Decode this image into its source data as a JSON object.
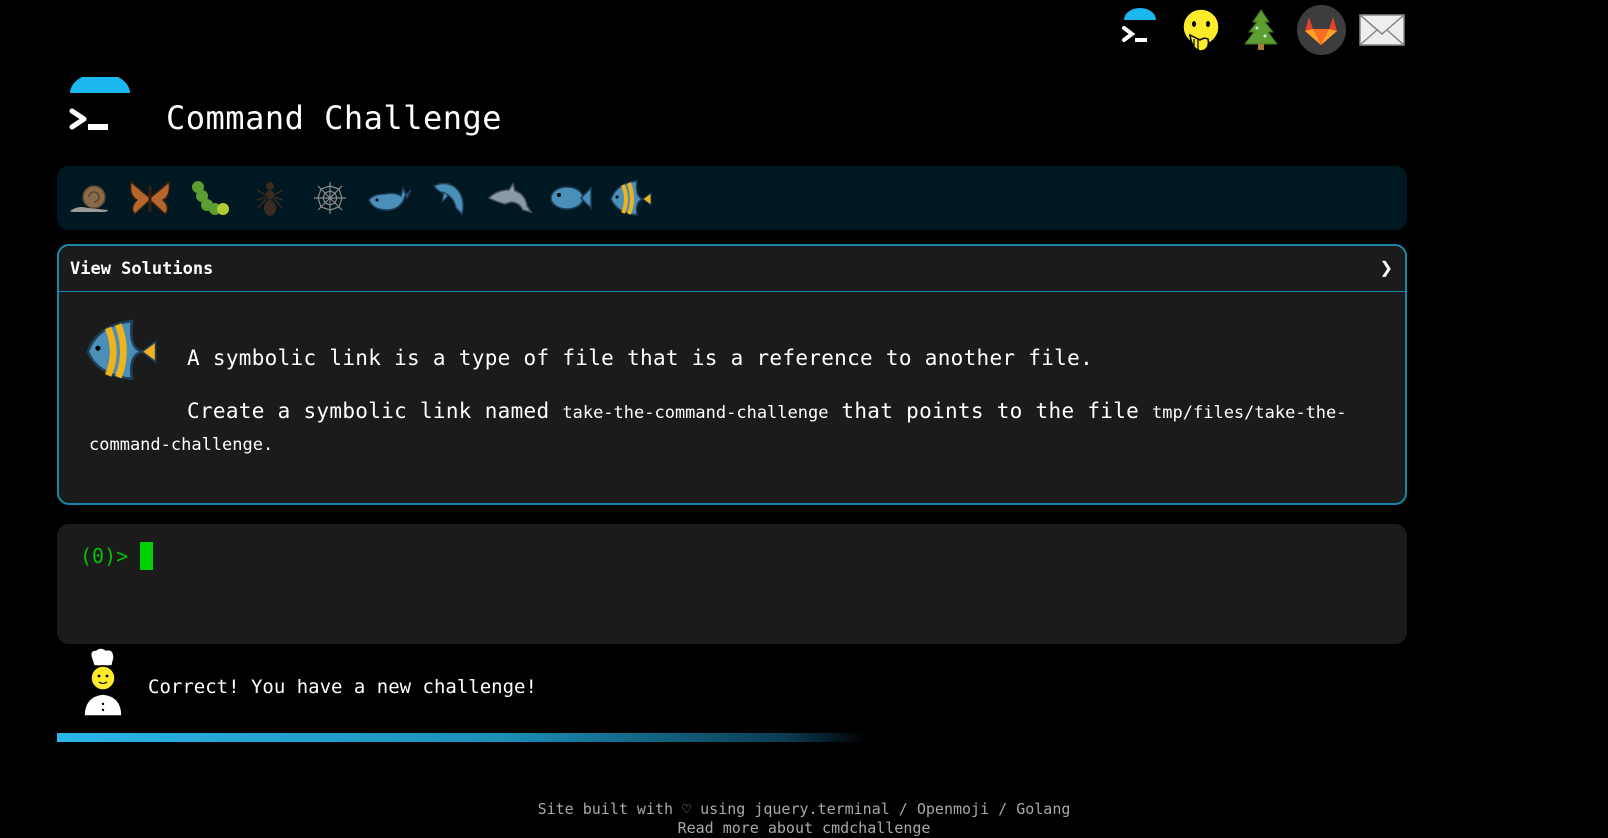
{
  "header": {
    "title": "Command Challenge"
  },
  "top_icons": [
    {
      "name": "cmdchallenge-icon"
    },
    {
      "name": "face-hand-over-mouth-icon"
    },
    {
      "name": "tree-icon"
    },
    {
      "name": "gitlab-icon"
    },
    {
      "name": "mail-icon"
    }
  ],
  "levels": [
    {
      "name": "snail-icon"
    },
    {
      "name": "butterfly-icon"
    },
    {
      "name": "caterpillar-icon"
    },
    {
      "name": "ant-icon"
    },
    {
      "name": "spiderweb-icon"
    },
    {
      "name": "whale-icon"
    },
    {
      "name": "shark-icon"
    },
    {
      "name": "dolphin-icon"
    },
    {
      "name": "fish-icon"
    },
    {
      "name": "tropical-fish-icon"
    }
  ],
  "challenge": {
    "header_label": "View Solutions",
    "chevron": "❯",
    "line1": "A symbolic link is a type of file that is a reference to another file.",
    "line2_a": "Create a symbolic link named ",
    "line2_code1": "take-the-command-challenge",
    "line2_b": " that points to the file ",
    "line2_code2": "tmp/files/take-the-command-challenge",
    "line2_c": "."
  },
  "terminal": {
    "prompt": "(0)>"
  },
  "message": {
    "text": "Correct! You have a new challenge!"
  },
  "progress": {
    "fraction": 0.6
  },
  "footer": {
    "line1": "Site built with ♡ using jquery.terminal / Openmoji / Golang",
    "line2": "Read more about cmdchallenge"
  },
  "colors": {
    "accent": "#1a86a8",
    "prompt": "#00c400",
    "progress": "#2ab6ea"
  }
}
